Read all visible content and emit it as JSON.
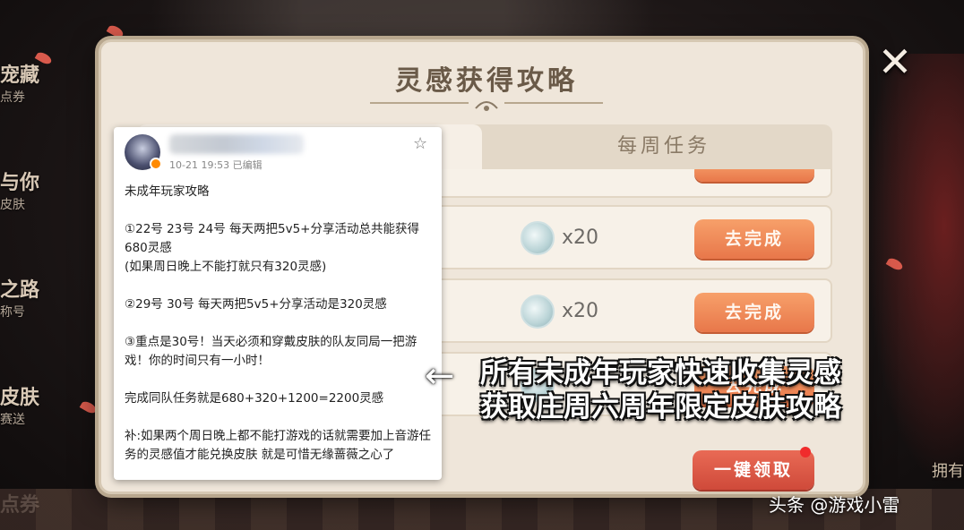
{
  "background": {
    "left_menu": [
      {
        "big": "宠藏",
        "small": "点券"
      },
      {
        "big": "与你",
        "small": "皮肤"
      },
      {
        "big": "之路",
        "small": "称号"
      },
      {
        "big": "皮肤",
        "small": "赛送"
      },
      {
        "big": "点券",
        "small": ""
      }
    ],
    "right_edge_text": "拥有"
  },
  "dialog": {
    "title": "灵感获得攻略",
    "close_glyph": "✕",
    "tabs": [
      {
        "label": "",
        "active": true
      },
      {
        "label": "每周任务",
        "active": false
      }
    ],
    "tasks": [
      {
        "reward": "x20",
        "button": "去完成"
      },
      {
        "reward": "x20",
        "button": "去完成"
      },
      {
        "reward": "",
        "button": "去完成"
      }
    ],
    "claim_all_label": "一键领取"
  },
  "post": {
    "meta": "10-21 19:53  已编辑",
    "star_glyph": "☆",
    "lines": [
      "未成年玩家攻略",
      "①22号 23号 24号 每天两把5v5+分享活动总共能获得680灵感",
      "(如果周日晚上不能打就只有320灵感)",
      "②29号 30号 每天两把5v5+分享活动是320灵感",
      "③重点是30号！当天必须和穿戴皮肤的队友同局一把游戏！你的时间只有一小时！",
      "完成同队任务就是680+320+1200=2200灵感",
      "补:如果两个周日晚上都不能打游戏的话就需要加上音游任务的灵感值才能兑换皮肤 就是可惜无缘蔷薇之心了"
    ]
  },
  "overlay": {
    "arrow_glyph": "←",
    "caption_line1": "所有未成年玩家快速收集灵感",
    "caption_line2": "获取庄周六周年限定皮肤攻略",
    "watermark": "头条 @游戏小雷"
  },
  "colors": {
    "panel": "#efe6da",
    "button_orange": "#e8774a",
    "claim_red": "#cf4a3a"
  }
}
